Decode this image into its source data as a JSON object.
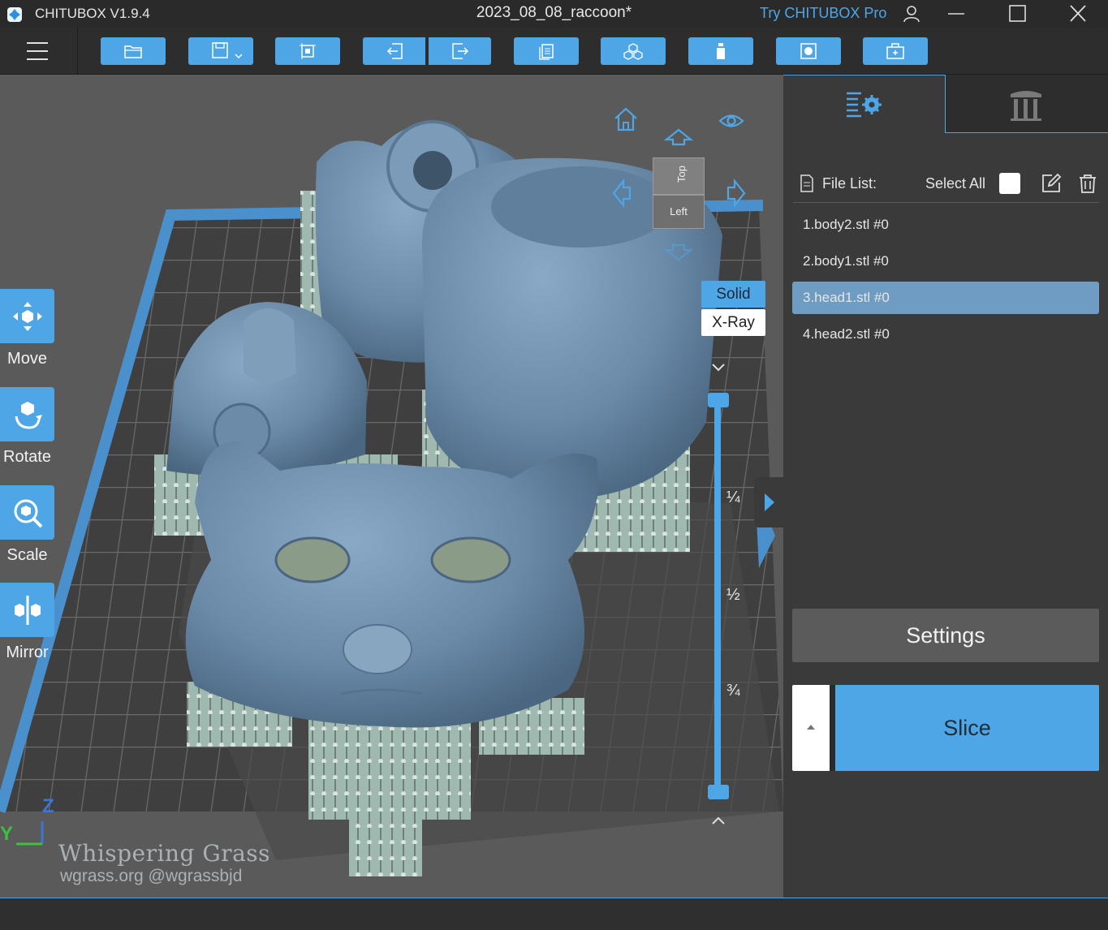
{
  "app": {
    "name": "CHITUBOX V1.9.4",
    "document_title": "2023_08_08_raccoon*",
    "try_pro": "Try CHITUBOX Pro"
  },
  "toolbar": {
    "buttons": [
      "open-file",
      "save",
      "auto-layout",
      "import",
      "export",
      "copy",
      "arrange",
      "support",
      "hollow",
      "add-base"
    ]
  },
  "left_tools": {
    "move": "Move",
    "rotate": "Rotate",
    "scale": "Scale",
    "mirror": "Mirror"
  },
  "view": {
    "cube_top": "Top",
    "cube_left": "Left",
    "mode_solid": "Solid",
    "mode_xray": "X-Ray",
    "slider_fractions": [
      "¼",
      "½",
      "¾"
    ],
    "axis_y": "Y",
    "axis_z": "Z",
    "watermark_title": "Whispering Grass",
    "watermark_sub": "wgrass.org @wgrassbjd"
  },
  "panel": {
    "file_list_label": "File List:",
    "select_all_label": "Select All",
    "files": [
      "1.body2.stl #0",
      "2.body1.stl #0",
      "3.head1.stl #0",
      "4.head2.stl #0"
    ],
    "selected_index": 2,
    "settings_label": "Settings",
    "slice_label": "Slice"
  },
  "colors": {
    "accent": "#4ea6e6",
    "model": "#6e8fae",
    "selected_row": "#6e9cc3"
  }
}
